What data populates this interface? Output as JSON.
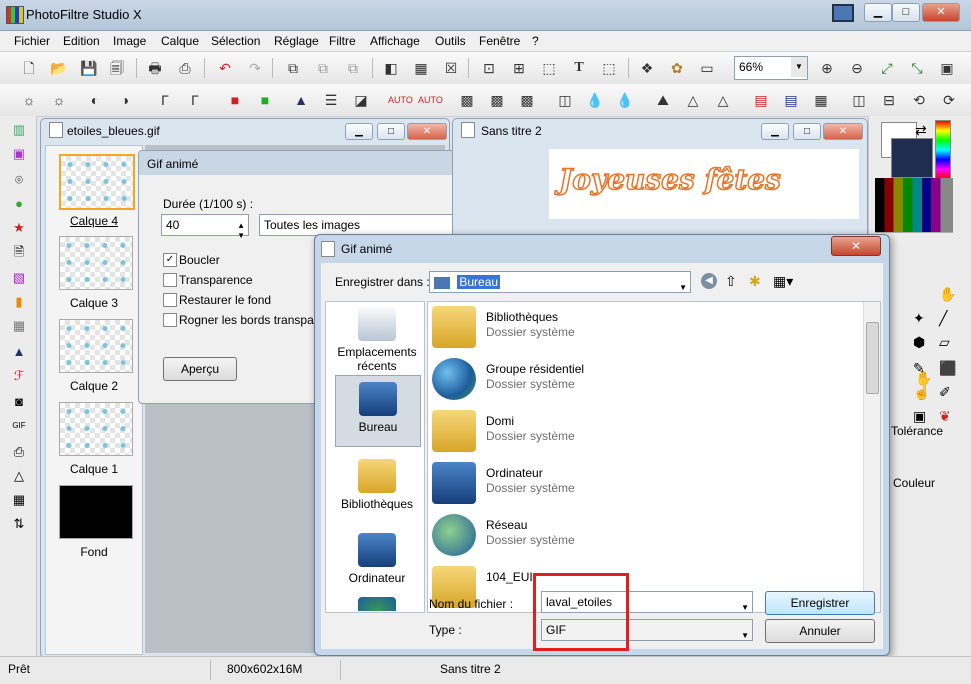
{
  "app": {
    "title": "PhotoFiltre Studio X"
  },
  "menu": [
    "Fichier",
    "Edition",
    "Image",
    "Calque",
    "Sélection",
    "Réglage",
    "Filtre",
    "Affichage",
    "Outils",
    "Fenêtre",
    "?"
  ],
  "toolbar": {
    "zoom": "66%"
  },
  "doc1": {
    "title": "etoiles_bleues.gif",
    "layers": [
      {
        "label": "Calque 4"
      },
      {
        "label": "Calque 3"
      },
      {
        "label": "Calque 2"
      },
      {
        "label": "Calque 1"
      },
      {
        "label": "Fond"
      }
    ]
  },
  "doc2": {
    "title": "Sans titre 2",
    "canvas_text": "Joyeuses fêtes"
  },
  "gifdialog": {
    "title": "Gif animé",
    "duration_label": "Durée (1/100 s) :",
    "duration_value": "40",
    "images_select": "Toutes les images",
    "checkboxes": [
      {
        "label": "Boucler",
        "checked": true
      },
      {
        "label": "Transparence",
        "checked": false
      },
      {
        "label": "Restaurer le fond",
        "checked": false
      },
      {
        "label": "Rogner les bords transparents",
        "checked": false
      }
    ],
    "preview_button": "Aperçu"
  },
  "savedialog": {
    "title": "Gif animé",
    "save_in_label": "Enregistrer dans :",
    "save_in_value": "Bureau",
    "places": [
      {
        "label": "Emplacements récents"
      },
      {
        "label": "Bureau"
      },
      {
        "label": "Bibliothèques"
      },
      {
        "label": "Ordinateur"
      },
      {
        "label": ""
      }
    ],
    "files": [
      {
        "name": "Bibliothèques",
        "type": "Dossier système"
      },
      {
        "name": "Groupe résidentiel",
        "type": "Dossier système"
      },
      {
        "name": "Domi",
        "type": "Dossier système"
      },
      {
        "name": "Ordinateur",
        "type": "Dossier système"
      },
      {
        "name": "Réseau",
        "type": "Dossier système"
      },
      {
        "name": "104_EUI",
        "type": ""
      }
    ],
    "filename_label": "Nom du fichier :",
    "filename_value": "laval_etoiles",
    "type_label": "Type :",
    "type_value": "GIF",
    "save_button": "Enregistrer",
    "cancel_button": "Annuler"
  },
  "rightpanel": {
    "tolerance_label": "Tolérance",
    "color_label": "Couleur"
  },
  "status": {
    "ready": "Prêt",
    "size": "800x602x16M",
    "doc": "Sans titre 2"
  },
  "colors": {
    "highlight": "#e02020",
    "accent": "#3874d8"
  }
}
